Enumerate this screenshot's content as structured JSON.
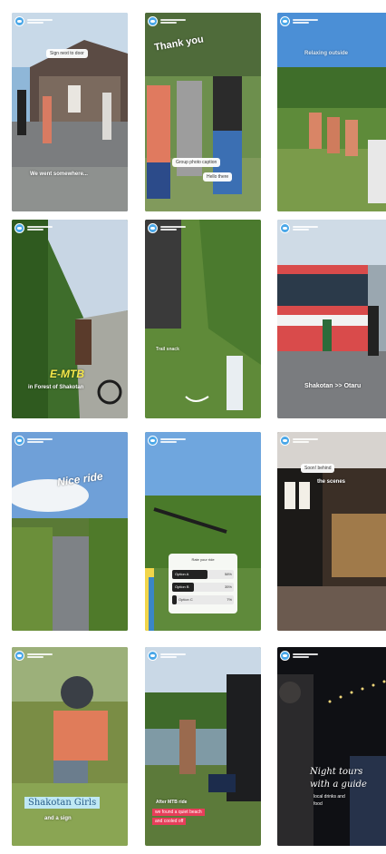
{
  "stories": [
    {
      "id": "tile-1",
      "captions": [
        "Sign next to door",
        "We went somewhere..."
      ]
    },
    {
      "id": "tile-2",
      "captions": [
        "Thank you",
        "Group photo caption",
        "Hello there"
      ]
    },
    {
      "id": "tile-3",
      "captions": [
        "Relaxing outside"
      ]
    },
    {
      "id": "tile-4",
      "captions": [
        "E-MTB",
        "in Forest of Shakotan"
      ]
    },
    {
      "id": "tile-5",
      "captions": [
        "Trail snack"
      ]
    },
    {
      "id": "tile-6",
      "captions": [
        "Shakotan >> Otaru"
      ]
    },
    {
      "id": "tile-7",
      "captions": [
        "Nice ride"
      ]
    },
    {
      "id": "tile-8",
      "captions": [
        "Rate your ride",
        "Option A",
        "Option B",
        "Option C",
        "58%",
        "35%",
        "7%"
      ]
    },
    {
      "id": "tile-9",
      "captions": [
        "Soon! behind",
        "the scenes"
      ]
    },
    {
      "id": "tile-10",
      "captions": [
        "Shakotan Girls",
        "and a sign"
      ]
    },
    {
      "id": "tile-11",
      "captions": [
        "After MTB ride",
        "we found a quiet beach",
        "and cooled off"
      ]
    },
    {
      "id": "tile-12",
      "captions": [
        "Night tours",
        "with a guide",
        "local drinks and",
        "food"
      ]
    }
  ]
}
